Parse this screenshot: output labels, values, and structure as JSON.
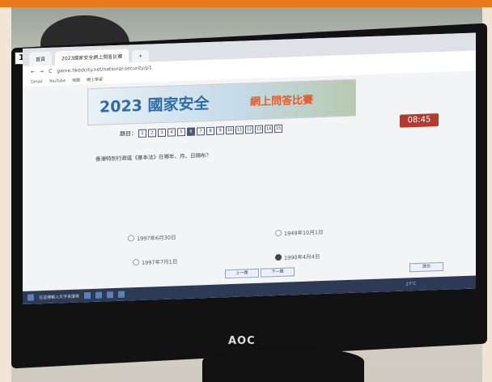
{
  "badge": "15",
  "browser": {
    "tabs": [
      {
        "label": "首頁"
      },
      {
        "label": "2023國家安全網上問答比賽"
      }
    ],
    "new_tab": "+",
    "url": "game.hkedcity.net/national-security/p1",
    "bookmarks": [
      "Gmail",
      "YouTube",
      "地圖",
      "網上學習"
    ]
  },
  "banner": {
    "title": "2023 國家安全",
    "subtitle": "網上問答比賽"
  },
  "quiz": {
    "questions_label": "題目：",
    "question_numbers": [
      "1",
      "2",
      "3",
      "4",
      "5",
      "6",
      "7",
      "8",
      "9",
      "10",
      "11",
      "12",
      "13",
      "14",
      "15"
    ],
    "current_question": "6",
    "timer": "08:45",
    "question_text": "香港特別行政區《基本法》在哪年、月、日頒布？",
    "options": [
      {
        "label": "1997年6月30日",
        "selected": false
      },
      {
        "label": "1949年10月1日",
        "selected": false
      },
      {
        "label": "1997年7月1日",
        "selected": false
      },
      {
        "label": "1990年4月4日",
        "selected": true
      }
    ],
    "prev_label": "上一題",
    "next_label": "下一題",
    "submit_label": "提交"
  },
  "taskbar": {
    "search": "在這裡輸入文字來搜尋",
    "weather": "27°C"
  },
  "monitor_brand": "AOC"
}
